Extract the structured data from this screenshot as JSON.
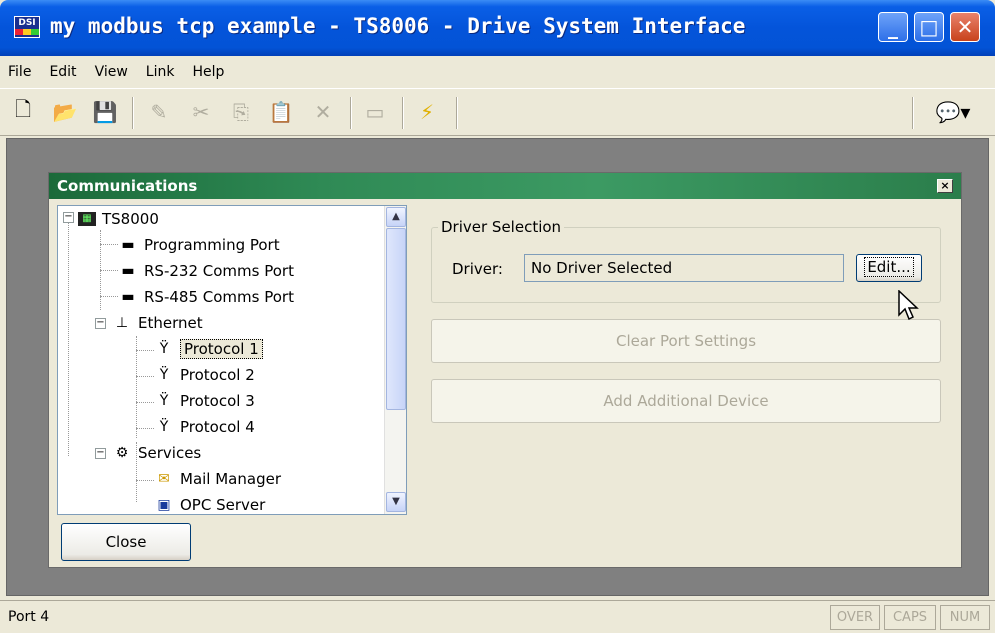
{
  "window": {
    "title": "my modbus tcp example - TS8006 - Drive System Interface",
    "icon_label": "DSI",
    "controls": {
      "minimize": "minimize-icon",
      "maximize": "maximize-icon",
      "close": "close-icon"
    }
  },
  "menu": [
    "File",
    "Edit",
    "View",
    "Link",
    "Help"
  ],
  "toolbar": {
    "tools": [
      "new-icon",
      "open-icon",
      "save-icon",
      "pencil-icon",
      "cut-icon",
      "copy-icon",
      "paste-icon",
      "delete-icon",
      "window-icon",
      "lightning-icon",
      "comment-icon"
    ]
  },
  "dialog": {
    "title": "Communications",
    "tree": {
      "root": "TS8000",
      "items": [
        {
          "label": "Programming Port"
        },
        {
          "label": "RS-232 Comms Port"
        },
        {
          "label": "RS-485 Comms Port"
        },
        {
          "label": "Ethernet"
        },
        {
          "label": "Protocol 1"
        },
        {
          "label": "Protocol 2"
        },
        {
          "label": "Protocol 3"
        },
        {
          "label": "Protocol 4"
        },
        {
          "label": "Services"
        },
        {
          "label": "Mail Manager"
        },
        {
          "label": "OPC Server"
        }
      ],
      "selected": "Protocol 1"
    },
    "driver_group": {
      "legend": "Driver Selection",
      "driver_label": "Driver:",
      "driver_value": "No Driver Selected",
      "edit_button": "Edit..."
    },
    "clear_button": "Clear Port Settings",
    "add_button": "Add Additional Device",
    "close_button": "Close"
  },
  "status": {
    "text": "Port 4",
    "indicators": [
      "OVER",
      "CAPS",
      "NUM"
    ]
  }
}
